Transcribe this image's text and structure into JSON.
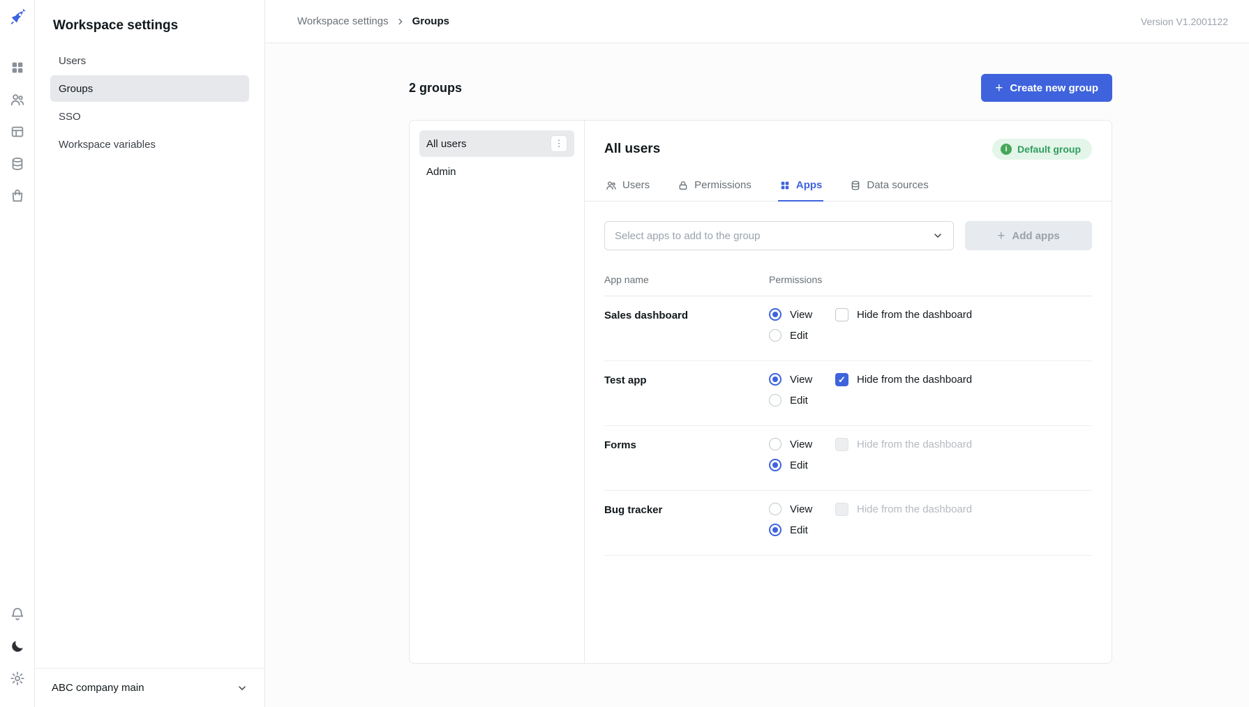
{
  "app": {
    "version_label": "Version V1.2001122"
  },
  "icon_sidebar": {
    "top_icons": [
      "rocket-logo",
      "apps-grid",
      "users",
      "audit-layout",
      "database-layers",
      "marketplace-bag"
    ],
    "bottom_icons": [
      "bell",
      "moon",
      "gear"
    ]
  },
  "settings_sidebar": {
    "title": "Workspace settings",
    "items": [
      {
        "label": "Users",
        "active": false
      },
      {
        "label": "Groups",
        "active": true
      },
      {
        "label": "SSO",
        "active": false
      },
      {
        "label": "Workspace variables",
        "active": false
      }
    ],
    "workspace_switcher": "ABC company main"
  },
  "breadcrumb": {
    "root": "Workspace settings",
    "current": "Groups"
  },
  "groups": {
    "count_label": "2 groups",
    "create_button_label": "Create new group",
    "list": [
      {
        "name": "All users",
        "active": true
      },
      {
        "name": "Admin",
        "active": false
      }
    ],
    "detail": {
      "title": "All users",
      "badge_label": "Default group",
      "tabs": [
        {
          "label": "Users",
          "active": false
        },
        {
          "label": "Permissions",
          "active": false
        },
        {
          "label": "Apps",
          "active": true
        },
        {
          "label": "Data sources",
          "active": false
        }
      ],
      "select_placeholder": "Select apps to add to the  group",
      "add_apps_label": "Add apps",
      "table": {
        "headers": [
          "App name",
          "Permissions"
        ],
        "view_label": "View",
        "edit_label": "Edit",
        "hide_label": "Hide from the dashboard",
        "rows": [
          {
            "app": "Sales dashboard",
            "permission": "view",
            "hide_checked": false,
            "hide_disabled": false
          },
          {
            "app": "Test app",
            "permission": "view",
            "hide_checked": true,
            "hide_disabled": false
          },
          {
            "app": "Forms",
            "permission": "edit",
            "hide_checked": false,
            "hide_disabled": true
          },
          {
            "app": "Bug tracker",
            "permission": "edit",
            "hide_checked": false,
            "hide_disabled": true
          }
        ]
      }
    }
  },
  "colors": {
    "accent": "#3e63dd",
    "badge_bg": "#e4f5e9",
    "badge_text": "#2f9e5f",
    "badge_icon": "#46a758",
    "sidebar_active_bg": "#e6e8eb",
    "border": "#e6e8eb"
  }
}
